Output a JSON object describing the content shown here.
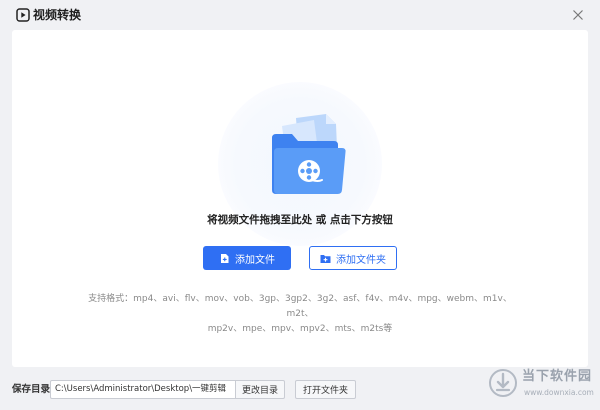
{
  "window": {
    "title": "视频转换",
    "app_icon": "video-convert-icon",
    "close_icon": "close-icon"
  },
  "dropzone": {
    "illustration": "video-folder-icon",
    "hint": "将视频文件拖拽至此处 或 点击下方按钮"
  },
  "actions": {
    "add_file_label": "添加文件",
    "add_file_icon": "file-plus-icon",
    "add_folder_label": "添加文件夹",
    "add_folder_icon": "folder-plus-icon"
  },
  "formats": {
    "line1": "支持格式：mp4、avi、flv、mov、vob、3gp、3gp2、3g2、asf、f4v、m4v、mpg、webm、m1v、m2t、",
    "line2": "mp2v、mpe、mpv、mpv2、mts、m2ts等"
  },
  "footer": {
    "save_label": "保存目录",
    "save_path": "C:\\Users\\Administrator\\Desktop\\一键剪辑",
    "change_dir_label": "更改目录",
    "open_folder_label": "打开文件夹"
  },
  "watermark": {
    "text": "当下软件园",
    "url": "www.downxia.com"
  },
  "colors": {
    "accent": "#2f6ff3",
    "background": "#f0f1f4",
    "panel": "#ffffff"
  }
}
